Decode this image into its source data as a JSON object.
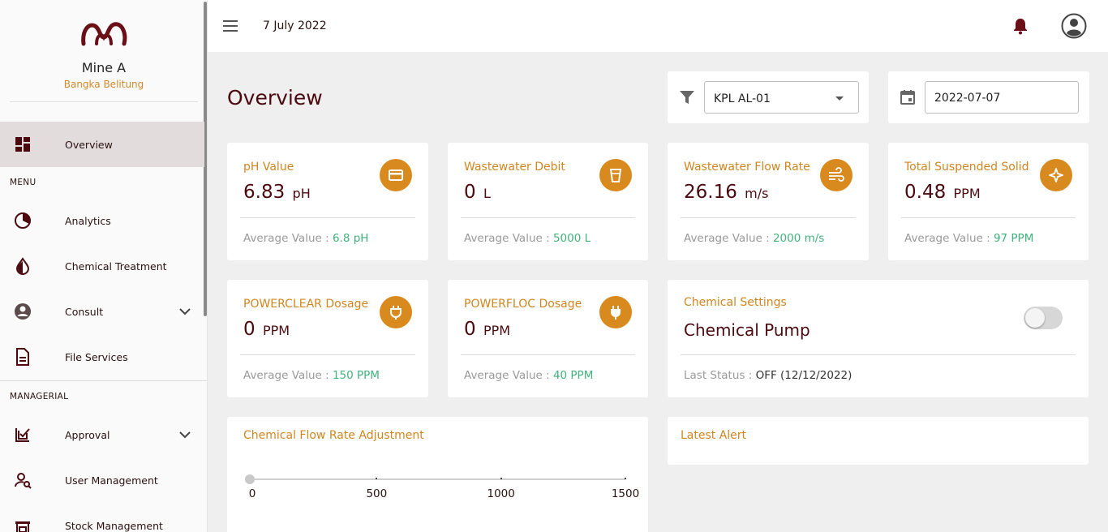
{
  "header": {
    "date": "7 July 2022"
  },
  "brand": {
    "name": "Mine A",
    "location": "Bangka Belitung"
  },
  "sidebar": {
    "overview": "Overview",
    "menu_label": "MENU",
    "menu_items": [
      {
        "label": "Analytics",
        "icon": "analytics-icon"
      },
      {
        "label": "Chemical Treatment",
        "icon": "droplet-icon"
      },
      {
        "label": "Consult",
        "icon": "account-circle-icon"
      },
      {
        "label": "File Services",
        "icon": "document-icon"
      }
    ],
    "managerial_label": "MANAGERIAL",
    "managerial_items": [
      {
        "label": "Approval",
        "icon": "approval-icon"
      },
      {
        "label": "User Management",
        "icon": "user-search-icon"
      },
      {
        "label": "Stock Management",
        "icon": "warehouse-icon"
      }
    ]
  },
  "page": {
    "title": "Overview",
    "filter": {
      "selected": "KPL AL-01"
    },
    "date_input": {
      "value": "2022-07-07"
    }
  },
  "avg_prefix": "Average Value : ",
  "metrics": [
    {
      "title": "pH Value",
      "value": "6.83",
      "unit": "pH",
      "avg": "6.8 pH",
      "icon": "credit-card-icon"
    },
    {
      "title": "Wastewater Debit",
      "value": "0",
      "unit": "L",
      "avg": "5000 L",
      "icon": "cup-icon"
    },
    {
      "title": "Wastewater Flow Rate",
      "value": "26.16",
      "unit": "m/s",
      "avg": "2000 m/s",
      "icon": "wind-icon"
    },
    {
      "title": "Total Suspended Solid",
      "value": "0.48",
      "unit": "PPM",
      "avg": "97 PPM",
      "icon": "sparkle-icon"
    },
    {
      "title": "POWERCLEAR Dosage",
      "value": "0",
      "unit": "PPM",
      "avg": "150 PPM",
      "icon": "plug-outline-icon"
    },
    {
      "title": "POWERFLOC Dosage",
      "value": "0",
      "unit": "PPM",
      "avg": "40 PPM",
      "icon": "plug-icon"
    }
  ],
  "chemical_settings": {
    "title": "Chemical Settings",
    "name": "Chemical Pump",
    "status_label": "Last Status : ",
    "status_value": "OFF (12/12/2022)",
    "toggle_on": false
  },
  "flow_adjustment": {
    "title": "Chemical Flow Rate Adjustment",
    "min": 0,
    "max": 1500,
    "value": 0,
    "ticks": [
      "0",
      "500",
      "1000",
      "1500"
    ]
  },
  "latest_alert": {
    "title": "Latest Alert"
  },
  "colors": {
    "accent": "#d98a1e",
    "brand": "#5a0f14",
    "positive": "#3fb37b",
    "active_bg": "#e3dcdc"
  }
}
